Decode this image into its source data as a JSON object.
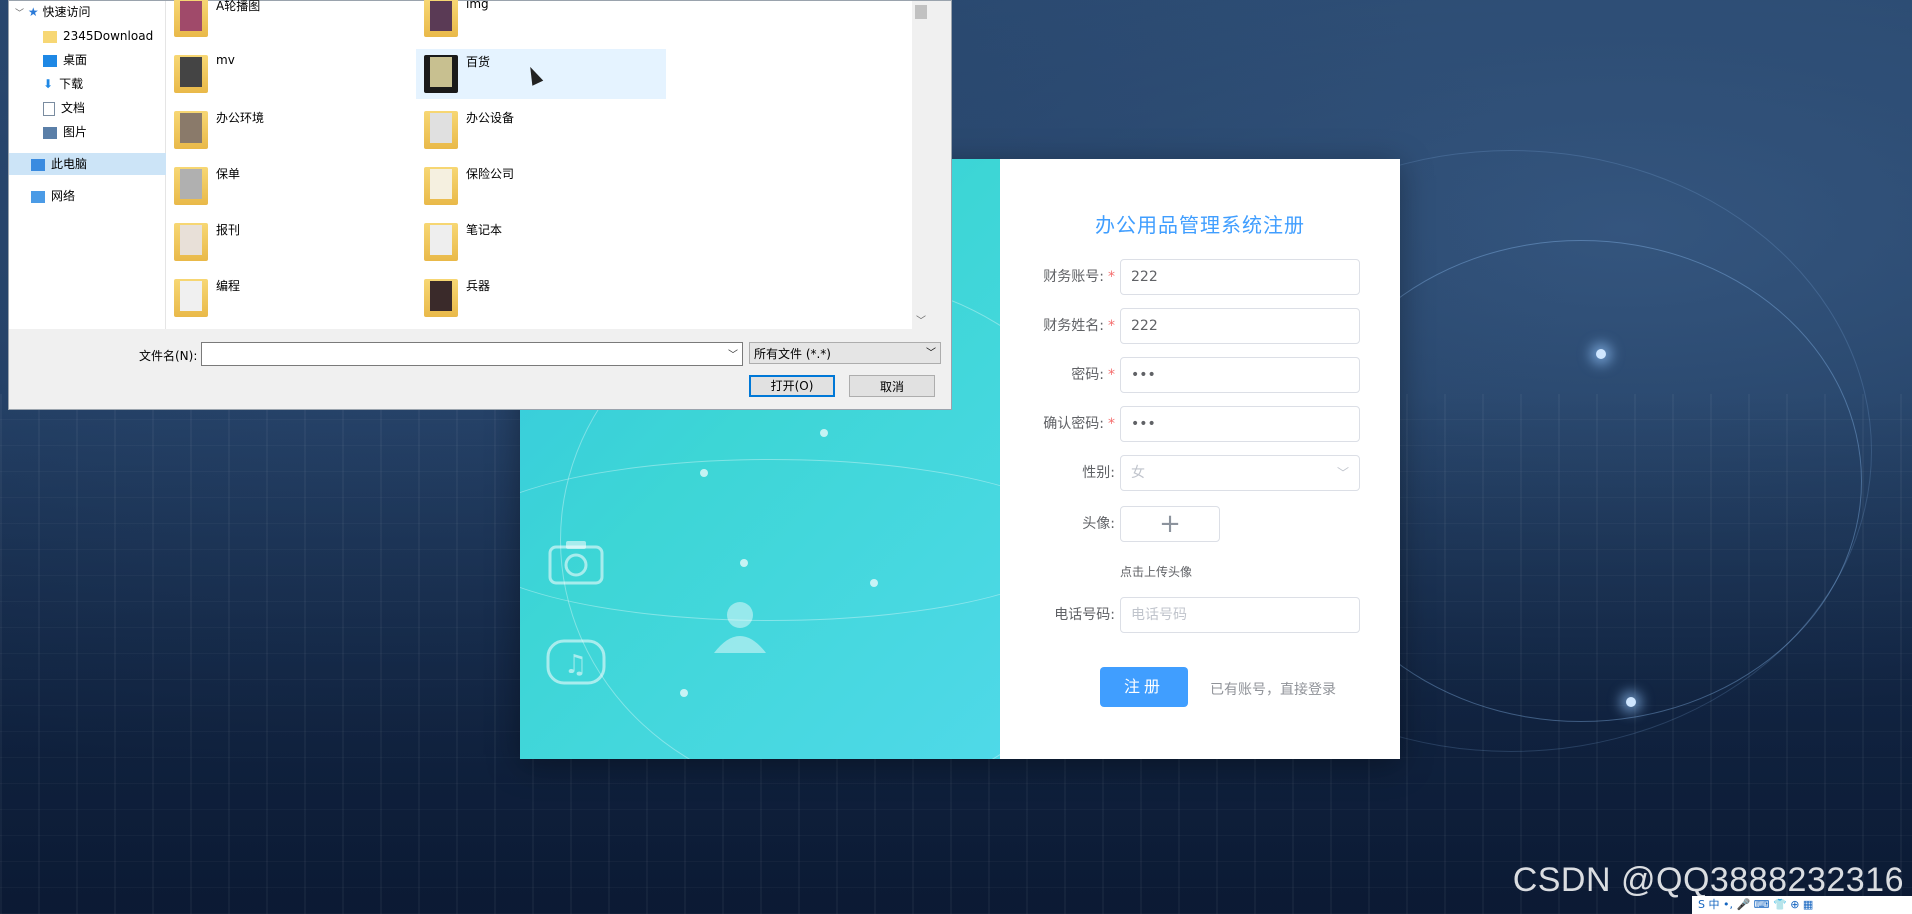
{
  "dialog": {
    "nav": [
      {
        "label": "快速访问",
        "icon": "star-icon"
      },
      {
        "label": "2345Download",
        "icon": "folder-icon",
        "pinned": true
      },
      {
        "label": "桌面",
        "icon": "desktop-icon",
        "pinned": true
      },
      {
        "label": "下载",
        "icon": "download-icon",
        "pinned": true
      },
      {
        "label": "文档",
        "icon": "document-icon",
        "pinned": true
      },
      {
        "label": "图片",
        "icon": "picture-icon",
        "pinned": true
      },
      {
        "label": "此电脑",
        "icon": "computer-icon",
        "selected": true
      },
      {
        "label": "网络",
        "icon": "network-icon"
      }
    ],
    "files": [
      {
        "name": "A轮播图"
      },
      {
        "name": "img"
      },
      {
        "name": "mv"
      },
      {
        "name": "百货"
      },
      {
        "name": "办公环境"
      },
      {
        "name": "办公设备"
      },
      {
        "name": "保单"
      },
      {
        "name": "保险公司"
      },
      {
        "name": "报刊"
      },
      {
        "name": "笔记本"
      },
      {
        "name": "编程"
      },
      {
        "name": "兵器"
      }
    ],
    "filename_label": "文件名(N):",
    "filename_value": "",
    "filetype": "所有文件 (*.*)",
    "open_button": "打开(O)",
    "cancel_button": "取消"
  },
  "form": {
    "title": "办公用品管理系统注册",
    "fields": [
      {
        "label": "财务账号:",
        "required": true,
        "value": "222",
        "placeholder": ""
      },
      {
        "label": "财务姓名:",
        "required": true,
        "value": "222",
        "placeholder": ""
      },
      {
        "label": "密码:",
        "required": true,
        "value": "•••",
        "placeholder": ""
      },
      {
        "label": "确认密码:",
        "required": true,
        "value": "•••",
        "placeholder": ""
      },
      {
        "label": "性别:",
        "required": false,
        "value": "女",
        "placeholder": ""
      },
      {
        "label": "头像:",
        "required": false,
        "value": "",
        "placeholder": ""
      },
      {
        "label": "电话号码:",
        "required": false,
        "value": "",
        "placeholder": "电话号码"
      }
    ],
    "upload_tip": "点击上传头像",
    "register_button": "注册",
    "login_link": "已有账号，直接登录"
  },
  "watermark": "CSDN @QQ3888232316",
  "tray_text": "S 中 •, 🎤 ⌨ 👕 ⊕ ▦"
}
